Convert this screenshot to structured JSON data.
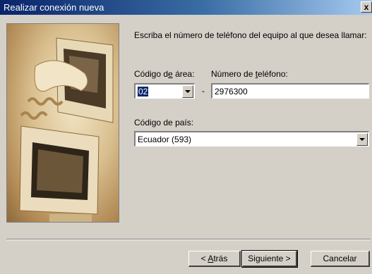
{
  "window": {
    "title": "Realizar conexión nueva",
    "close_glyph": "x"
  },
  "content": {
    "intro": "Escriba el número de teléfono del equipo al que desea llamar:",
    "area_code_label_pre": "Código d",
    "area_code_label_accel": "e",
    "area_code_label_post": " área:",
    "area_code_value": "02",
    "phone_label": "Número de teléfono:",
    "phone_label_accel_pre": "Número de ",
    "phone_label_accel": "t",
    "phone_label_accel_post": "eléfono:",
    "phone_value": "2976300",
    "dash": "-",
    "country_label_pre": "Códi",
    "country_label_accel": "g",
    "country_label_post": "o de país:",
    "country_value": "Ecuador (593)"
  },
  "buttons": {
    "back_pre": "< ",
    "back_accel": "A",
    "back_post": "trás",
    "next": "Siguiente >",
    "cancel": "Cancelar"
  },
  "icons": {
    "picture": "computer-and-phone-illustration",
    "dropdown": "chevron-down-icon",
    "close": "close-icon"
  }
}
